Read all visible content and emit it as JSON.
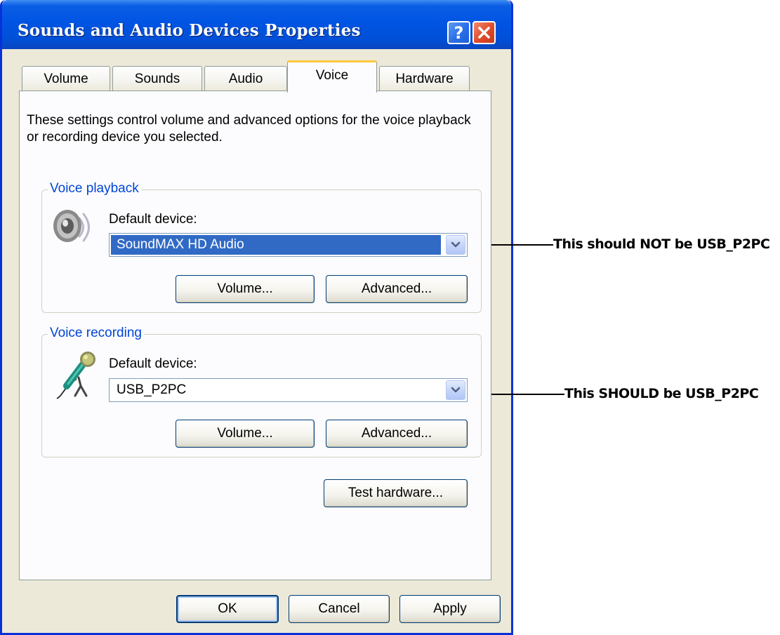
{
  "window": {
    "title": "Sounds and Audio Devices Properties",
    "help_glyph": "?"
  },
  "tabs": [
    {
      "label": "Volume",
      "active": false
    },
    {
      "label": "Sounds",
      "active": false
    },
    {
      "label": "Audio",
      "active": false
    },
    {
      "label": "Voice",
      "active": true
    },
    {
      "label": "Hardware",
      "active": false
    }
  ],
  "voice_tab": {
    "description": "These settings control volume and advanced options for the voice playback or recording device you selected.",
    "playback": {
      "group_label": "Voice playback",
      "device_label": "Default device:",
      "device_value": "SoundMAX HD Audio",
      "volume_button": "Volume...",
      "advanced_button": "Advanced..."
    },
    "recording": {
      "group_label": "Voice recording",
      "device_label": "Default device:",
      "device_value": "USB_P2PC",
      "volume_button": "Volume...",
      "advanced_button": "Advanced..."
    },
    "test_hardware_button": "Test hardware..."
  },
  "footer": {
    "ok": "OK",
    "cancel": "Cancel",
    "apply": "Apply"
  },
  "annotations": {
    "playback_note": "This should NOT be USB_P2PC",
    "recording_note": "This SHOULD be USB_P2PC"
  },
  "colors": {
    "titlebar": "#0054e3",
    "dialog_bg": "#ece9d8",
    "tab_active_accent": "#ffc83c",
    "selection": "#316ac5",
    "group_label": "#0046d5"
  },
  "icons": {
    "playback": "speaker-icon",
    "recording": "microphone-icon",
    "dropdown": "chevron-down-icon",
    "close": "close-icon",
    "help": "help-icon"
  }
}
